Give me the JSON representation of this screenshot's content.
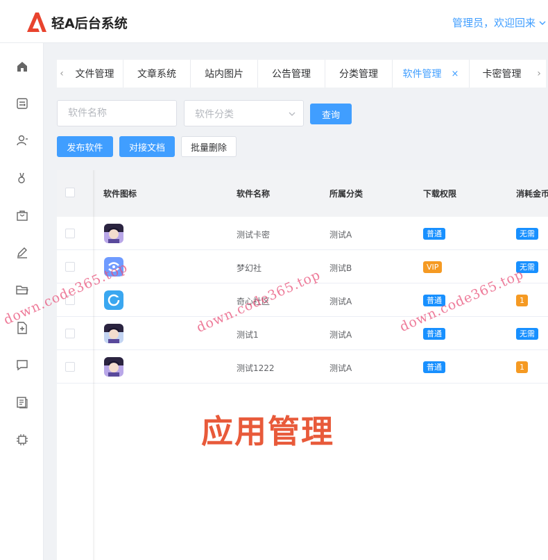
{
  "app": {
    "title": "轻A后台系统",
    "user_greeting": "管理员，欢迎回来"
  },
  "sidebar": {
    "items": [
      {
        "icon": "home-icon"
      },
      {
        "icon": "dashboard-icon"
      },
      {
        "icon": "user-icon"
      },
      {
        "icon": "user-manage-icon"
      },
      {
        "icon": "bag-icon"
      },
      {
        "icon": "pen-icon"
      },
      {
        "icon": "folder-icon"
      },
      {
        "icon": "add-file-icon"
      },
      {
        "icon": "message-icon"
      },
      {
        "icon": "document-icon"
      },
      {
        "icon": "chip-icon"
      }
    ]
  },
  "tabs": [
    {
      "label": "文件管理",
      "active": false
    },
    {
      "label": "文章系统",
      "active": false
    },
    {
      "label": "站内图片",
      "active": false
    },
    {
      "label": "公告管理",
      "active": false
    },
    {
      "label": "分类管理",
      "active": false
    },
    {
      "label": "软件管理",
      "active": true,
      "close": "×"
    },
    {
      "label": "卡密管理",
      "active": false
    }
  ],
  "tab_nav": {
    "prev": "‹",
    "next": "›"
  },
  "filter": {
    "name_placeholder": "软件名称",
    "category_placeholder": "软件分类",
    "query_label": "查询"
  },
  "actions": {
    "publish_label": "发布软件",
    "docs_label": "对接文档",
    "batch_delete_label": "批量删除"
  },
  "table": {
    "columns": [
      "软件图标",
      "软件名称",
      "所属分类",
      "下载权限",
      "消耗金币"
    ],
    "rows": [
      {
        "name": "测试卡密",
        "category": "测试A",
        "permission": "普通",
        "perm_color": "#1890ff",
        "cost": "无需",
        "cost_color": "#1890ff",
        "icon": "anime-avatar-icon"
      },
      {
        "name": "梦幻社",
        "category": "测试B",
        "permission": "VIP",
        "perm_color": "#f59a23",
        "cost": "无需",
        "cost_color": "#1890ff",
        "icon": "dream-logo-icon"
      },
      {
        "name": "奇心社区",
        "category": "测试A",
        "permission": "普通",
        "perm_color": "#1890ff",
        "cost": "1",
        "cost_color": "#f59a23",
        "icon": "community-logo-icon"
      },
      {
        "name": "测试1",
        "category": "测试A",
        "permission": "普通",
        "perm_color": "#1890ff",
        "cost": "无需",
        "cost_color": "#1890ff",
        "icon": "anime-avatar-icon"
      },
      {
        "name": "测试1222",
        "category": "测试A",
        "permission": "普通",
        "perm_color": "#1890ff",
        "cost": "1",
        "cost_color": "#f59a23",
        "icon": "anime-avatar-icon"
      }
    ]
  },
  "banner": "应用管理",
  "watermark": "down.code365.top",
  "colors": {
    "accent": "#409eff",
    "banner": "#e85a3a",
    "logo": "#e8432e"
  }
}
